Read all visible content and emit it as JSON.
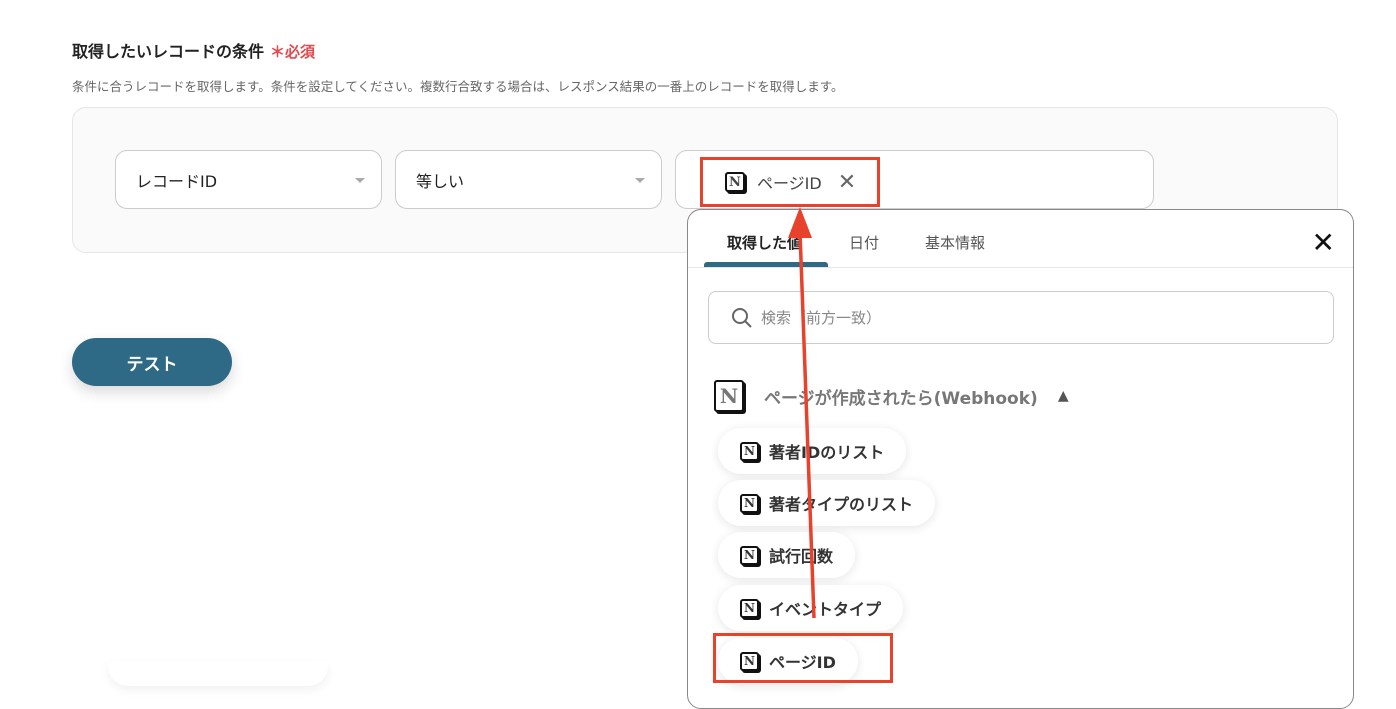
{
  "section": {
    "title": "取得したいレコードの条件",
    "required_mark": "＊",
    "required_label": "必須",
    "description": "条件に合うレコードを取得します。条件を設定してください。複数行合致する場合は、レスポンス結果の一番上のレコードを取得します。"
  },
  "condition": {
    "field": "レコードID",
    "operator": "等しい",
    "value_chip": "ページID"
  },
  "test_button": "テスト",
  "popup": {
    "tabs": [
      {
        "label": "取得した値"
      },
      {
        "label": "日付"
      },
      {
        "label": "基本情報"
      }
    ],
    "search_placeholder": "検索（前方一致）",
    "group_label": "ページが作成されたら(Webhook)",
    "items": [
      {
        "label": "著者IDのリスト"
      },
      {
        "label": "著者タイプのリスト"
      },
      {
        "label": "試行回数"
      },
      {
        "label": "イベントタイプ"
      },
      {
        "label": "ページID"
      }
    ]
  },
  "colors": {
    "accent": "#2e6a85",
    "annotation": "#e8412c",
    "required": "#e5484d"
  },
  "icons": {
    "app": "notion-icon",
    "close": "close-icon",
    "search": "search-icon"
  }
}
